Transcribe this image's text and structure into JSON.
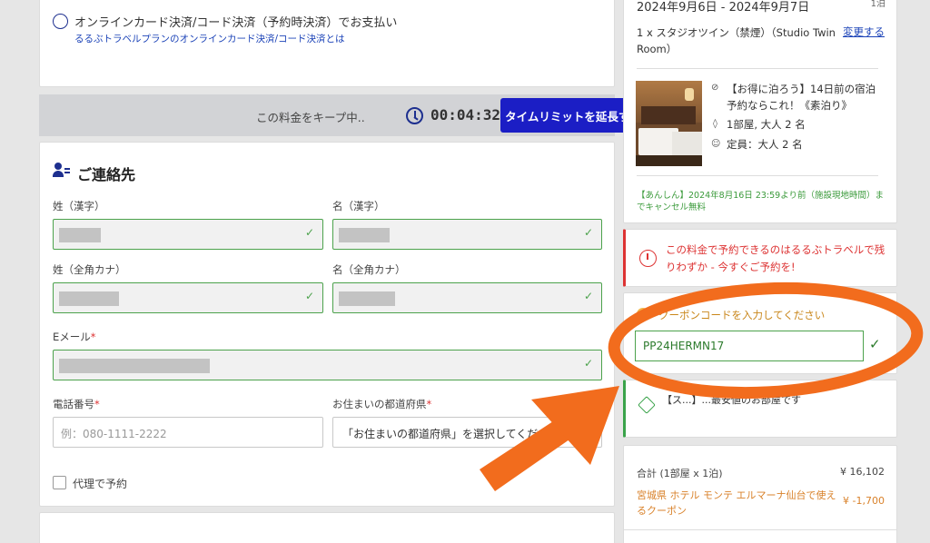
{
  "payment": {
    "option_label": "オンラインカード決済/コード決済（予約時決済）でお支払い",
    "info_link": "るるぶトラベルプランのオンラインカード決済/コード決済とは"
  },
  "timer": {
    "keep_text": "この料金をキープ中..",
    "time": "00:04:32",
    "extend_button": "タイムリミットを延長する"
  },
  "contact": {
    "title": "ご連絡先",
    "last_name_kanji_label": "姓（漢字）",
    "first_name_kanji_label": "名（漢字）",
    "last_name_kana_label": "姓（全角カナ）",
    "first_name_kana_label": "名（全角カナ）",
    "email_label": "Eメール",
    "phone_label": "電話番号",
    "phone_placeholder": "例：080-1111-2222",
    "prefecture_label": "お住まいの都道府県",
    "prefecture_value": "「お住まいの都道府県」を選択してください",
    "required_mark": "*",
    "proxy_label": "代理で予約"
  },
  "booking": {
    "dates": "2024年9月6日 - 2024年9月7日",
    "nights": "1泊",
    "room_line": "1 x スタジオツイン（禁煙）（Studio Twin Room）",
    "change_link": "変更する",
    "plan": "【お得に泊ろう】14日前の宿泊予約ならこれ！《素泊り》",
    "rooms_guests": "1部屋, 大人 2 名",
    "capacity": "定員：大人 2 名",
    "cancellation": "【あんしん】2024年8月16日 23:59より前（施設現地時間）までキャンセル無料"
  },
  "warning": {
    "text": "この料金で予約できるのはるるぶトラベルで残りわずか - 今すぐご予約を!"
  },
  "coupon": {
    "label": "クーポンコードを入力してください",
    "code": "PP24HERMN17"
  },
  "cheapest": {
    "text": "【ス...】...最安値のお部屋です"
  },
  "summary": {
    "total_label": "合計 (1部屋 x 1泊)",
    "total_value": "¥ 16,102",
    "discount_label": "宮城県 ホテル モンテ エルマーナ仙台で使えるクーポン",
    "discount_value": "¥ -1,700"
  },
  "colors": {
    "accent_blue": "#1b1ec5",
    "valid_green": "#4ca24c",
    "warning_red": "#d33333",
    "annotation_orange": "#f26c1d",
    "coupon_orange": "#d9822b"
  }
}
